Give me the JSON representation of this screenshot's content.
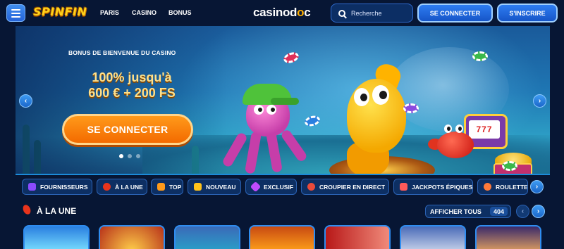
{
  "header": {
    "logo": "SPINFIN",
    "nav": [
      "PARIS",
      "CASINO",
      "BONUS"
    ],
    "brand_left": "casinod",
    "brand_mid": "o",
    "brand_right": "c",
    "search_placeholder": "Recherche",
    "login_label": "SE CONNECTER",
    "signup_label": "S'INSCRIRE"
  },
  "hero": {
    "eyebrow": "BONUS DE BIENVENUE DU CASINO",
    "offer_line1": "100% jusqu'à",
    "offer_line2": "600 € + 200 FS",
    "cta_label": "SE CONNECTER",
    "slot_win": "777",
    "active_slide": 1,
    "slide_count": 3
  },
  "categories": [
    {
      "label": "FOURNISSEURS",
      "icon": "providers-icon",
      "color": "#8b4bff"
    },
    {
      "label": "À LA UNE",
      "icon": "pepper-icon",
      "color": "#e8341c"
    },
    {
      "label": "TOP",
      "icon": "crown-icon",
      "color": "#ff9a1a"
    },
    {
      "label": "NOUVEAU",
      "icon": "lightning-icon",
      "color": "#ffc21a"
    },
    {
      "label": "EXCLUSIF",
      "icon": "gem-icon",
      "color": "#c04bff"
    },
    {
      "label": "CROUPIER EN DIRECT",
      "icon": "chip-icon",
      "color": "#e84a3a"
    },
    {
      "label": "JACKPOTS ÉPIQUES",
      "icon": "gift-icon",
      "color": "#ff5a5a"
    },
    {
      "label": "ROULETTE",
      "icon": "roulette-icon",
      "color": "#ff7a3a"
    }
  ],
  "section": {
    "title": "À LA UNE",
    "view_all_label": "AFFICHER TOUS",
    "view_all_count": "404"
  },
  "tiles": [
    "#2a7fe0",
    "#b8321a",
    "#2aa1c8",
    "#c84a12",
    "#b81818",
    "#4a6bb8",
    "#3a2a6a"
  ]
}
